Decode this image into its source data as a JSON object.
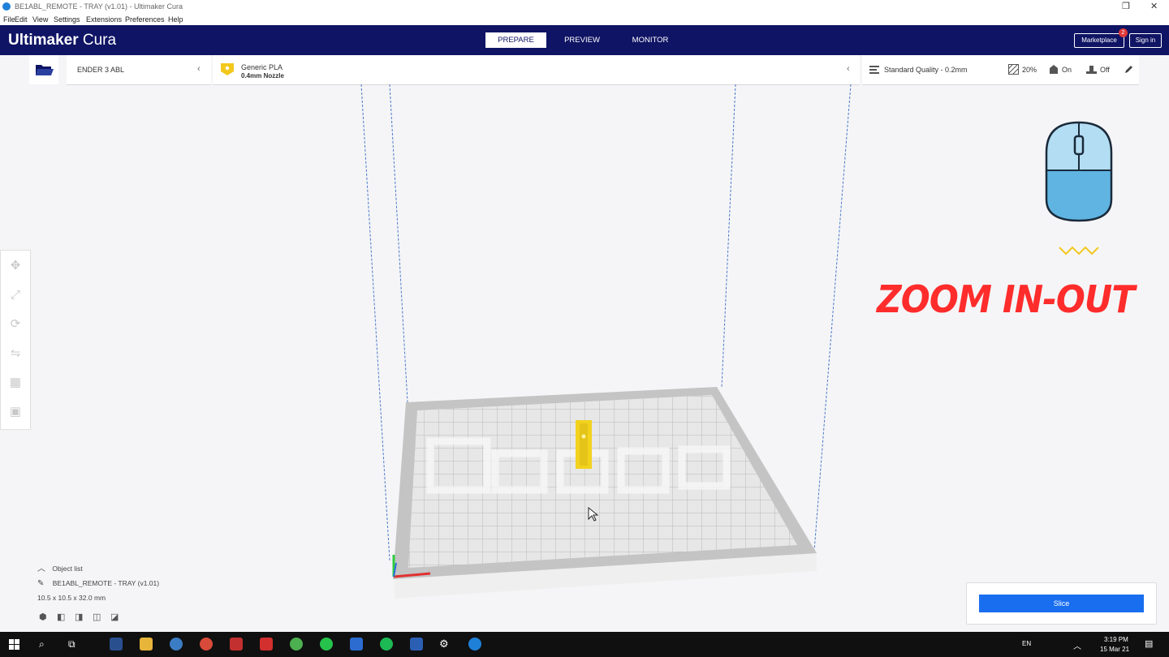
{
  "window": {
    "title": "BE1ABL_REMOTE - TRAY (v1.01) - Ultimaker Cura"
  },
  "menu": [
    "File",
    "Edit",
    "View",
    "Settings",
    "Extensions",
    "Preferences",
    "Help"
  ],
  "header": {
    "logo_bold": "Ultimaker",
    "logo_light": " Cura",
    "stages": [
      "PREPARE",
      "PREVIEW",
      "MONITOR"
    ],
    "marketplace": "Marketplace",
    "marketplace_badge": "2",
    "signin": "Sign in"
  },
  "printer": {
    "name": "ENDER 3 ABL"
  },
  "material": {
    "name": "Generic PLA",
    "nozzle": "0.4mm Nozzle"
  },
  "print_settings": {
    "profile": "Standard Quality - 0.2mm",
    "infill": "20%",
    "support": "On",
    "adhesion": "Off"
  },
  "overlay": {
    "text": "ZOOM IN-OUT"
  },
  "object_list": {
    "toggle_label": "Object list",
    "object_name": "BE1ABL_REMOTE - TRAY (v1.01)",
    "dimensions": "10.5 x 10.5 x 32.0 mm"
  },
  "slice": {
    "button_label": "Slice"
  },
  "taskbar": {
    "lang": "EN",
    "time": "3:19 PM",
    "date": "15 Mar 21"
  },
  "colors": {
    "header_bg": "#0f1464",
    "accent": "#196ef0",
    "overlay_red": "#ff2c2c"
  }
}
